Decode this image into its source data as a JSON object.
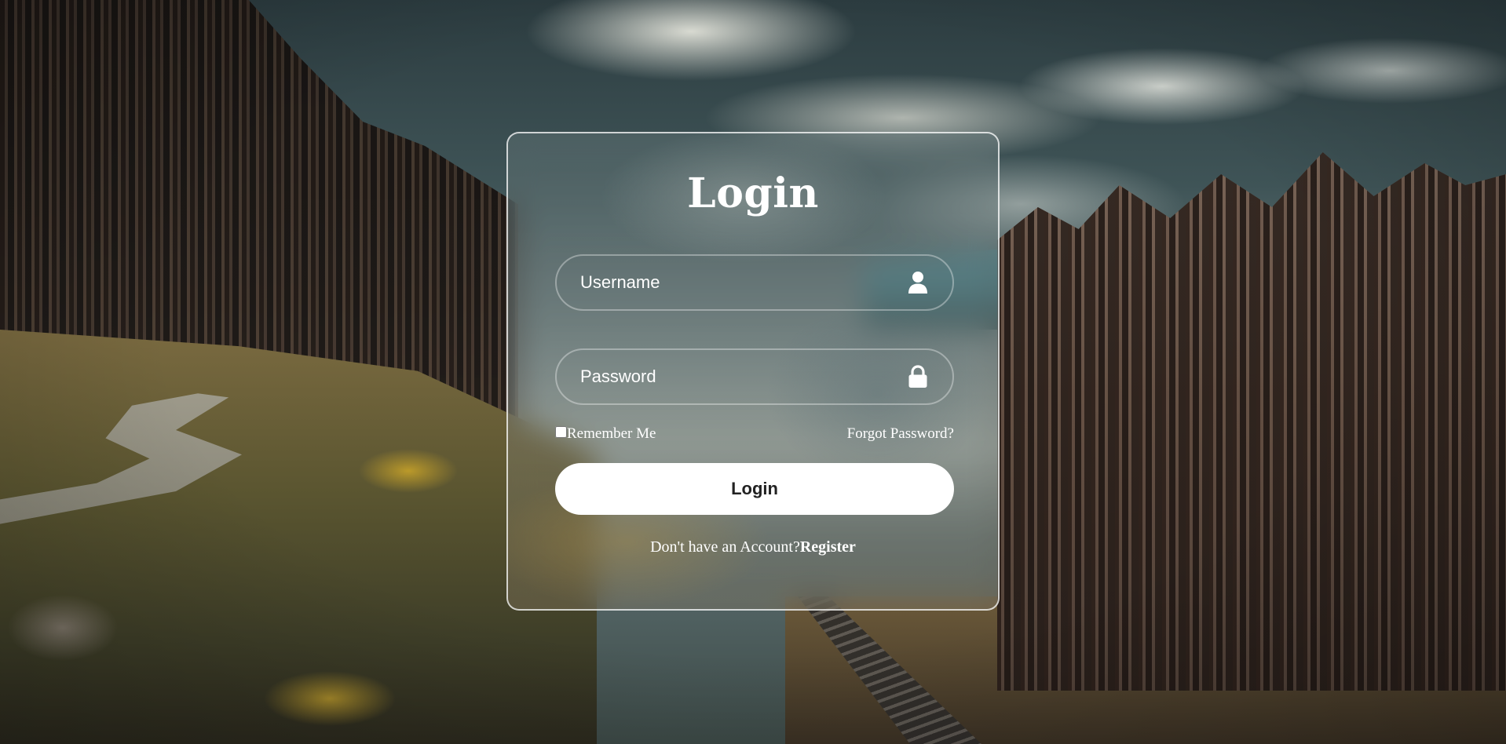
{
  "login_form": {
    "title": "Login",
    "username": {
      "placeholder": "Username",
      "value": "",
      "icon": "user-icon"
    },
    "password": {
      "placeholder": "Password",
      "value": "",
      "icon": "lock-icon"
    },
    "remember_me": {
      "label": "Remember Me",
      "checked": false
    },
    "forgot_password_label": "Forgot Password?",
    "submit_label": "Login",
    "register_prompt": "Don't have an Account?",
    "register_link_label": "Register"
  },
  "colors": {
    "card_border": "#ffffff",
    "button_background": "#ffffff",
    "button_text": "#222222",
    "text": "#ffffff"
  }
}
